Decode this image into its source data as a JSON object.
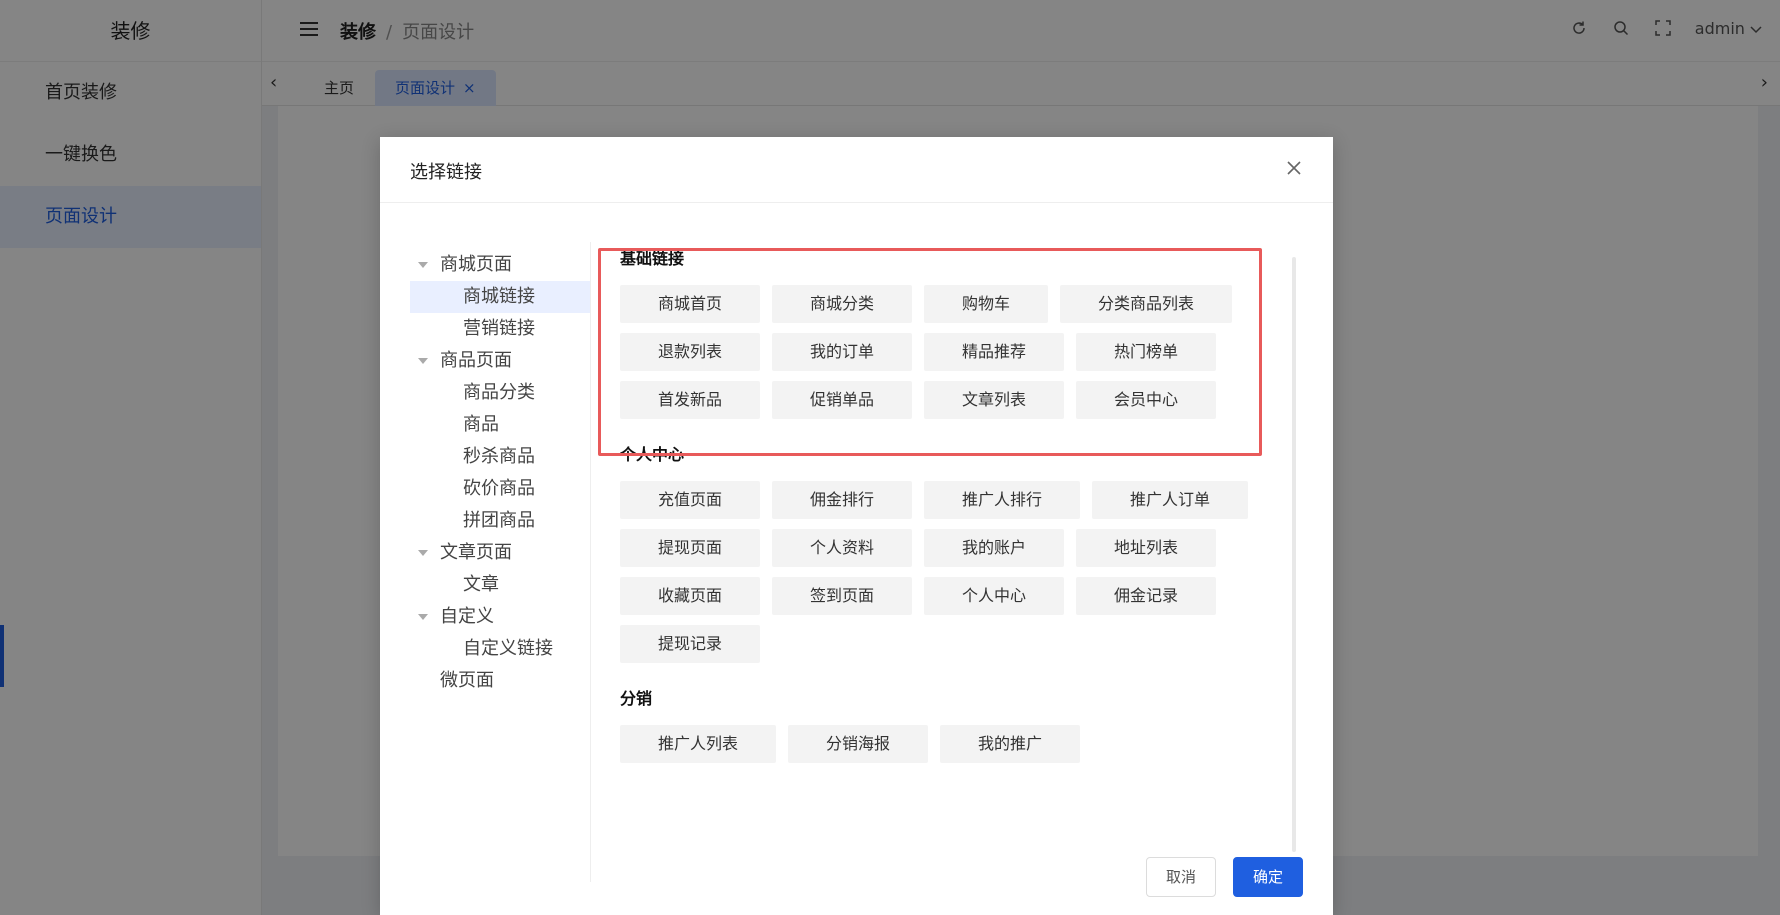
{
  "app": {
    "brand": "装修",
    "user": "admin"
  },
  "sidebar": {
    "items": [
      {
        "label": "首页装修"
      },
      {
        "label": "一键换色"
      },
      {
        "label": "页面设计"
      }
    ]
  },
  "header": {
    "breadcrumb_root": "装修",
    "breadcrumb_sep": "/",
    "breadcrumb_current": "页面设计"
  },
  "tabs": [
    {
      "label": "主页"
    },
    {
      "label": "页面设计",
      "closable": true
    }
  ],
  "modal": {
    "title": "选择链接",
    "tree": [
      {
        "label": "商城页面",
        "level": 0,
        "expanded": true
      },
      {
        "label": "商城链接",
        "level": 1,
        "selected": true
      },
      {
        "label": "营销链接",
        "level": 1
      },
      {
        "label": "商品页面",
        "level": 0,
        "expanded": true
      },
      {
        "label": "商品分类",
        "level": 1
      },
      {
        "label": "商品",
        "level": 1
      },
      {
        "label": "秒杀商品",
        "level": 1
      },
      {
        "label": "砍价商品",
        "level": 1
      },
      {
        "label": "拼团商品",
        "level": 1
      },
      {
        "label": "文章页面",
        "level": 0,
        "expanded": true
      },
      {
        "label": "文章",
        "level": 1
      },
      {
        "label": "自定义",
        "level": 0,
        "expanded": true
      },
      {
        "label": "自定义链接",
        "level": 1
      },
      {
        "label": "微页面",
        "level": 0
      }
    ],
    "sections": [
      {
        "title": "基础链接",
        "links": [
          "商城首页",
          "商城分类",
          "购物车",
          "分类商品列表",
          "退款列表",
          "我的订单",
          "精品推荐",
          "热门榜单",
          "首发新品",
          "促销单品",
          "文章列表",
          "会员中心"
        ]
      },
      {
        "title": "个人中心",
        "links": [
          "充值页面",
          "佣金排行",
          "推广人排行",
          "推广人订单",
          "提现页面",
          "个人资料",
          "我的账户",
          "地址列表",
          "收藏页面",
          "签到页面",
          "个人中心",
          "佣金记录",
          "提现记录"
        ]
      },
      {
        "title": "分销",
        "links": [
          "推广人列表",
          "分销海报",
          "我的推广"
        ]
      }
    ],
    "cancel_label": "取消",
    "ok_label": "确定"
  },
  "colors": {
    "accent": "#1f5fe0",
    "highlight": "#e85a5a"
  }
}
